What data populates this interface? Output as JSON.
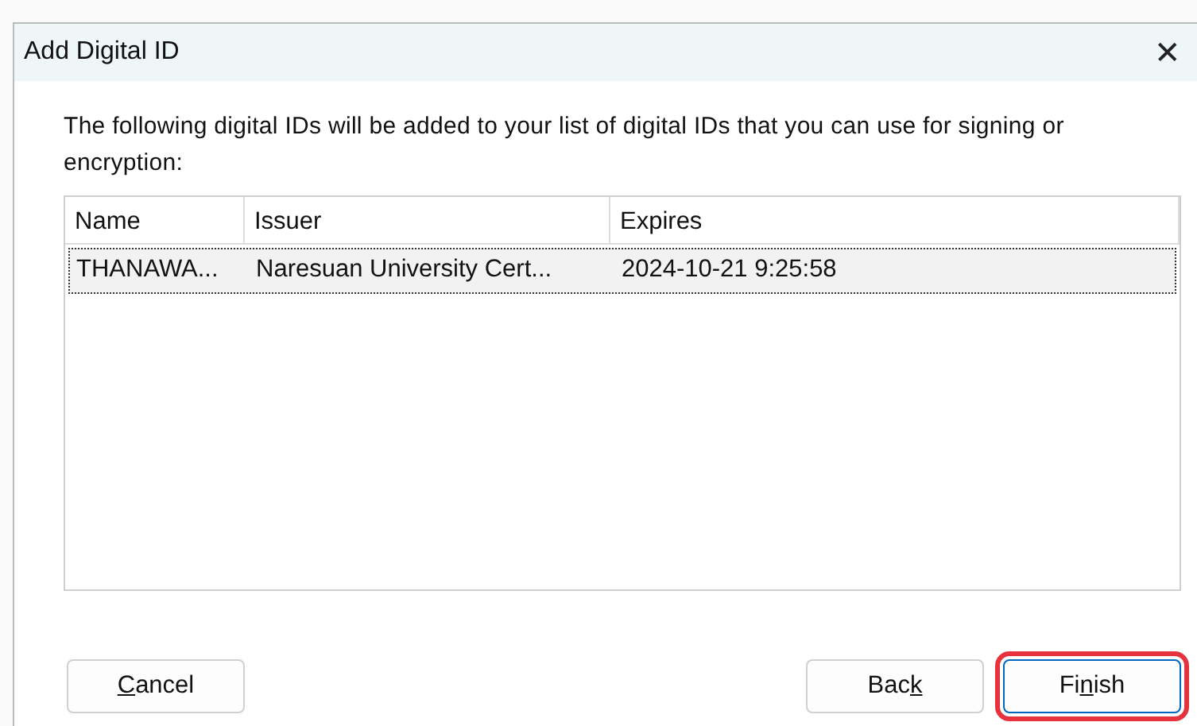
{
  "window": {
    "title": "Add Digital ID",
    "close": "✕"
  },
  "message": "The following digital IDs will be added to your list of digital IDs that you can use for signing or encryption:",
  "table": {
    "columns": [
      "Name",
      "Issuer",
      "Expires"
    ],
    "rows": [
      {
        "cells": [
          "THANAWA...",
          "Naresuan University Cert...",
          "2024-10-21 9:25:58"
        ],
        "selected": true
      }
    ]
  },
  "buttons": [
    {
      "kind": "cancel",
      "key": "C",
      "after": "ancel",
      "highlighted": false,
      "default": false
    },
    {
      "kind": "back",
      "before": "Bac",
      "key": "k",
      "highlighted": false,
      "default": false
    },
    {
      "kind": "finish",
      "before": "Fi",
      "key": "n",
      "after": "ish",
      "highlighted": true,
      "default": true
    }
  ]
}
